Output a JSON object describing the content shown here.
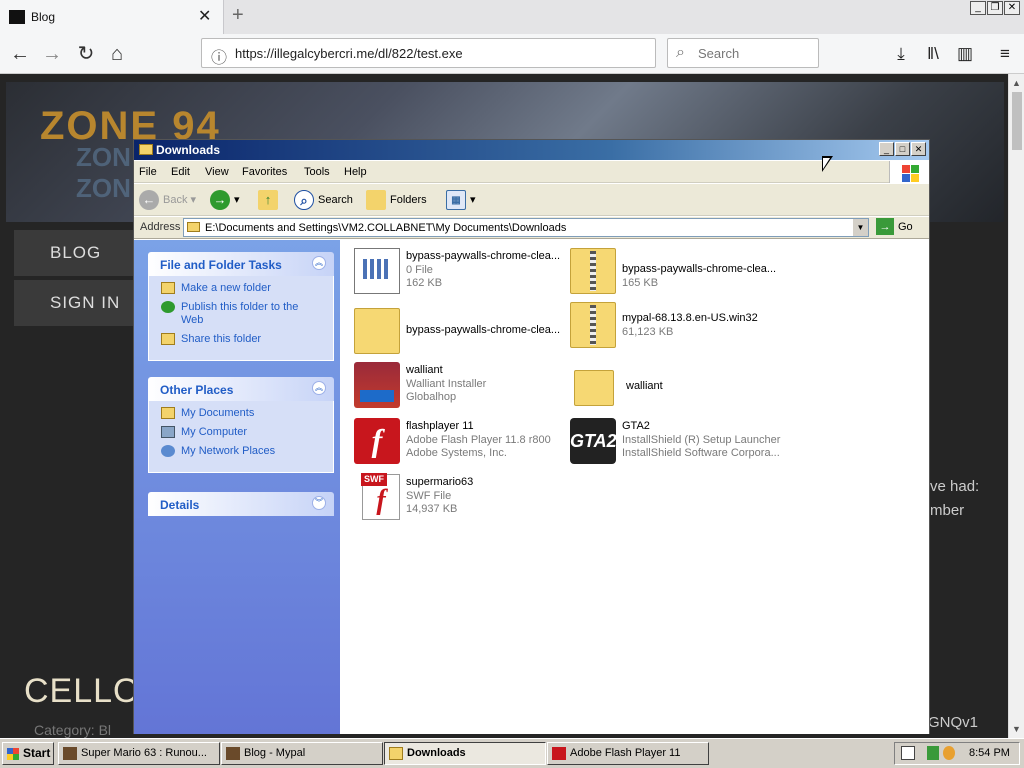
{
  "browser": {
    "tab_title": "Blog",
    "url": "https://illegalcybercri.me/dl/822/test.exe",
    "search_placeholder": "Search"
  },
  "website": {
    "logo": "ZONE 94",
    "nav": [
      "BLOG",
      "SIGN IN"
    ],
    "post_title": "CELLO C",
    "category_label": "Category: Bl",
    "side_text_1": "ve had:",
    "side_text_2": "mber",
    "side_text_3": "GNQv1"
  },
  "explorer": {
    "title": "Downloads",
    "menu": [
      "File",
      "Edit",
      "View",
      "Favorites",
      "Tools",
      "Help"
    ],
    "toolbar": {
      "back": "Back",
      "search": "Search",
      "folders": "Folders"
    },
    "address_label": "Address",
    "address_value": "E:\\Documents and Settings\\VM2.COLLABNET\\My Documents\\Downloads",
    "go_label": "Go",
    "tasks_panel": {
      "title": "File and Folder Tasks",
      "items": [
        "Make a new folder",
        "Publish this folder to the Web",
        "Share this folder"
      ]
    },
    "places_panel": {
      "title": "Other Places",
      "items": [
        "My Documents",
        "My Computer",
        "My Network Places"
      ]
    },
    "details_panel": {
      "title": "Details"
    },
    "files": [
      {
        "name": "bypass-paywalls-chrome-clea...",
        "line2": "0 File",
        "line3": "162 KB",
        "icon": "generic-file-icon"
      },
      {
        "name": "bypass-paywalls-chrome-clea...",
        "line2": "165 KB",
        "line3": "",
        "icon": "zip-folder-icon"
      },
      {
        "name": "bypass-paywalls-chrome-clea...",
        "line2": "",
        "line3": "",
        "icon": "folder-icon"
      },
      {
        "name": "mypal-68.13.8.en-US.win32",
        "line2": "61,123 KB",
        "line3": "",
        "icon": "zip-folder-icon"
      },
      {
        "name": "walliant",
        "line2": "Walliant Installer",
        "line3": "Globalhop",
        "icon": "walliant-icon"
      },
      {
        "name": "walliant",
        "line2": "",
        "line3": "",
        "icon": "folder-icon"
      },
      {
        "name": "flashplayer 11",
        "line2": "Adobe Flash Player 11.8 r800",
        "line3": "Adobe Systems, Inc.",
        "icon": "flash-icon"
      },
      {
        "name": "GTA2",
        "line2": "InstallShield (R) Setup Launcher",
        "line3": "InstallShield Software Corpora...",
        "icon": "gta2-icon"
      },
      {
        "name": "supermario63",
        "line2": "SWF File",
        "line3": "14,937 KB",
        "icon": "swf-file-icon"
      }
    ]
  },
  "taskbar": {
    "start": "Start",
    "tasks": [
      "Super Mario 63 : Runou...",
      "Blog - Mypal",
      "Downloads",
      "Adobe Flash Player 11"
    ],
    "clock": "8:54 PM"
  }
}
